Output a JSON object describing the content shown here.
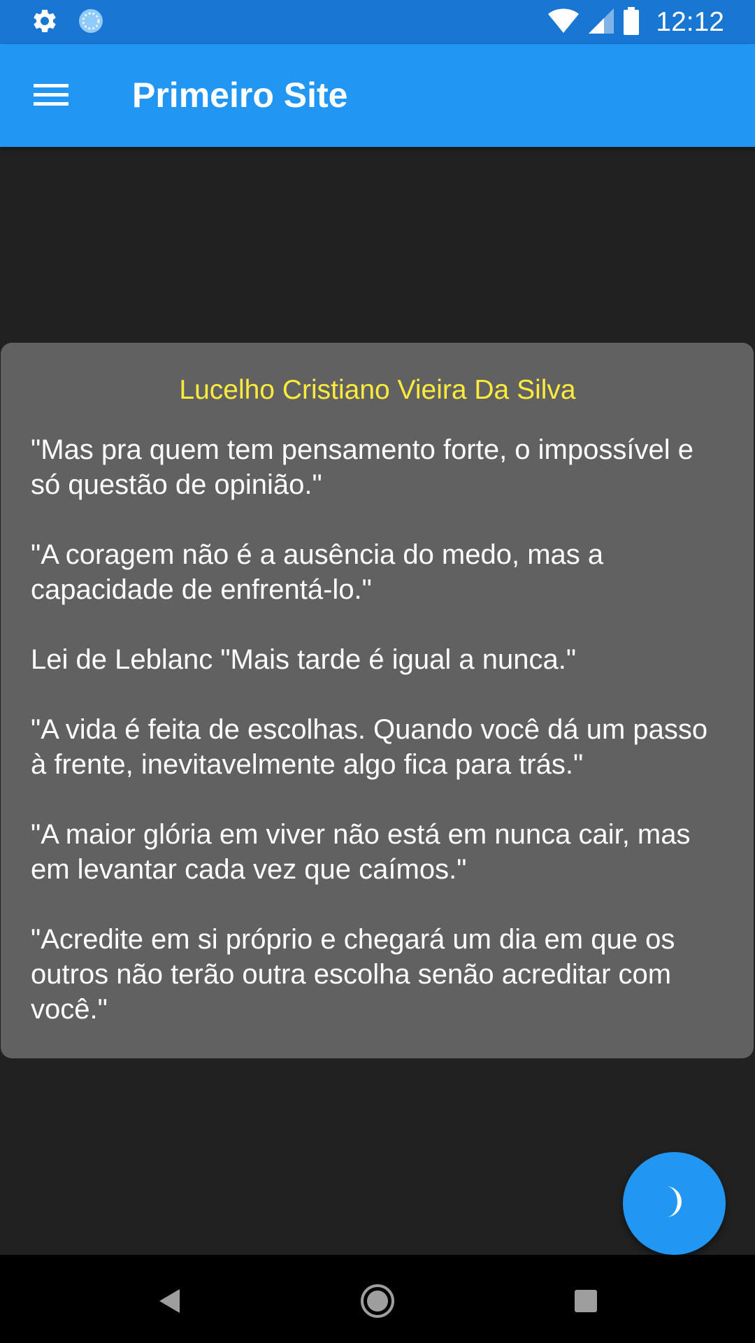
{
  "status_bar": {
    "time": "12:12",
    "icons": [
      "gear-icon",
      "sync-icon",
      "wifi-icon",
      "signal-icon",
      "battery-icon"
    ]
  },
  "app_bar": {
    "title": "Primeiro Site",
    "menu_icon": "hamburger-menu-icon"
  },
  "card": {
    "title": "Lucelho Cristiano Vieira Da Silva",
    "quotes": [
      "\"Mas pra quem tem pensamento forte, o impossível e só questão de opinião.\"",
      "\"A coragem não é a ausência do medo, mas a capacidade de enfrentá-lo.\"",
      "Lei de Leblanc \"Mais tarde é igual a nunca.\"",
      "\"A vida é feita de escolhas. Quando você dá um passo à frente, inevitavelmente algo fica para trás.\"",
      "\"A maior glória em viver não está em nunca cair, mas em levantar cada vez que caímos.\"",
      "\"Acredite em si próprio e chegará um dia em que os outros não terão outra escolha senão acreditar com você.\""
    ]
  },
  "fab": {
    "icon": "moon-icon"
  },
  "nav_bar": {
    "icons": [
      "back-icon",
      "home-icon",
      "recents-icon"
    ]
  },
  "colors": {
    "status_bar": "#1976D2",
    "app_bar": "#2196F3",
    "background": "#212121",
    "card": "#616161",
    "card_title": "#FFEB3B",
    "fab": "#2196F3"
  }
}
